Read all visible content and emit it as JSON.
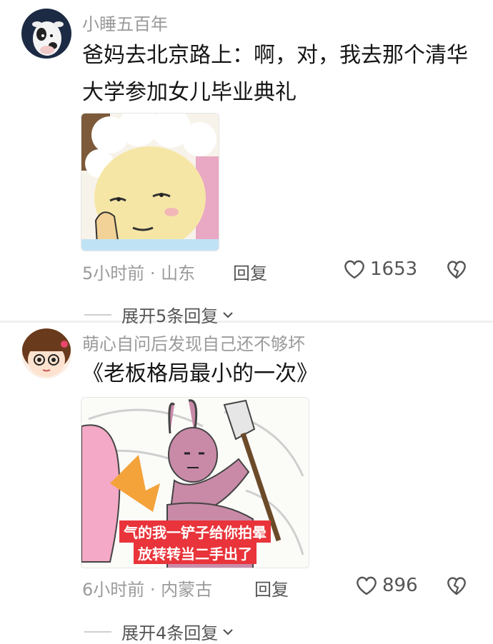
{
  "comments": [
    {
      "username": "小睡五百年",
      "content": "爸妈去北京路上：啊，对，我去那个清华大学参加女儿毕业典礼",
      "time_location": "5小时前 · 山东",
      "reply_label": "回复",
      "likes": "1653",
      "expand_label": "展开5条回复",
      "avatar_icon": "cow-avatar-icon",
      "sticker": "smug-sheep-sticker"
    },
    {
      "username": "萌心自问后发现自己还不够坏",
      "content": "《老板格局最小的一次》",
      "time_location": "6小时前 · 内蒙古",
      "reply_label": "回复",
      "likes": "896",
      "expand_label": "展开4条回复",
      "avatar_icon": "girl-avatar-icon",
      "sticker": "rabbit-shovel-sticker",
      "sticker_caption": [
        "气的我一铲子给你拍晕",
        "放转转当二手出了"
      ]
    }
  ],
  "colors": {
    "text": "#151515",
    "muted": "#9a9a9a",
    "caption_bg": "#e8343a"
  }
}
